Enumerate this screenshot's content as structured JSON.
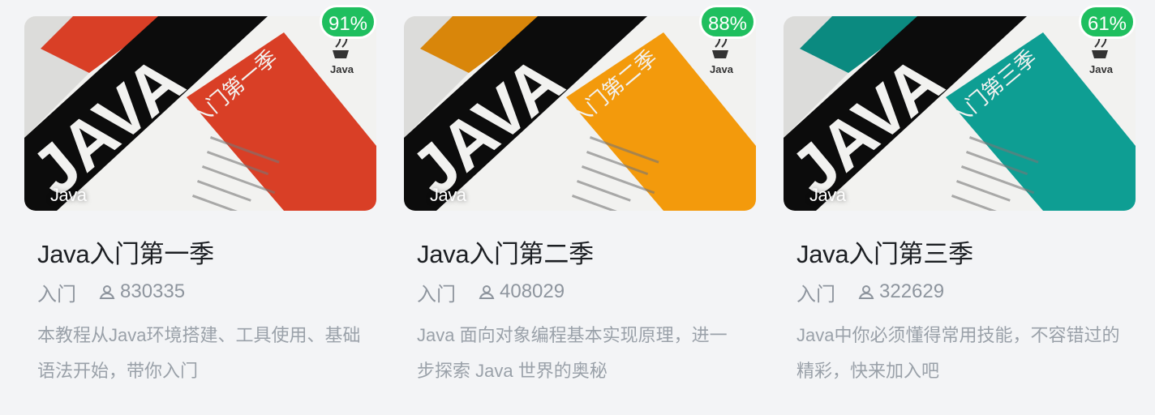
{
  "courses": [
    {
      "title": "Java入门第一季",
      "level": "入门",
      "students": "830335",
      "description": "本教程从Java环境搭建、工具使用、基础语法开始，带你入门",
      "progress": "91%",
      "tag": "Java",
      "banner_text": "Beginner 入门第一季",
      "accent_color": "#d93f26"
    },
    {
      "title": "Java入门第二季",
      "level": "入门",
      "students": "408029",
      "description": "Java 面向对象编程基本实现原理，进一步探索 Java 世界的奥秘",
      "progress": "88%",
      "tag": "Java",
      "banner_text": "Beginner 入门第二季",
      "accent_color": "#f39a0c"
    },
    {
      "title": "Java入门第三季",
      "level": "入门",
      "students": "322629",
      "description": "Java中你必须懂得常用技能，不容错过的精彩，快来加入吧",
      "progress": "61%",
      "tag": "Java",
      "banner_text": "Beginner 入门第三季",
      "accent_color": "#0e9e93"
    }
  ],
  "cover_logo": "JAVA",
  "java_badge": "Java"
}
